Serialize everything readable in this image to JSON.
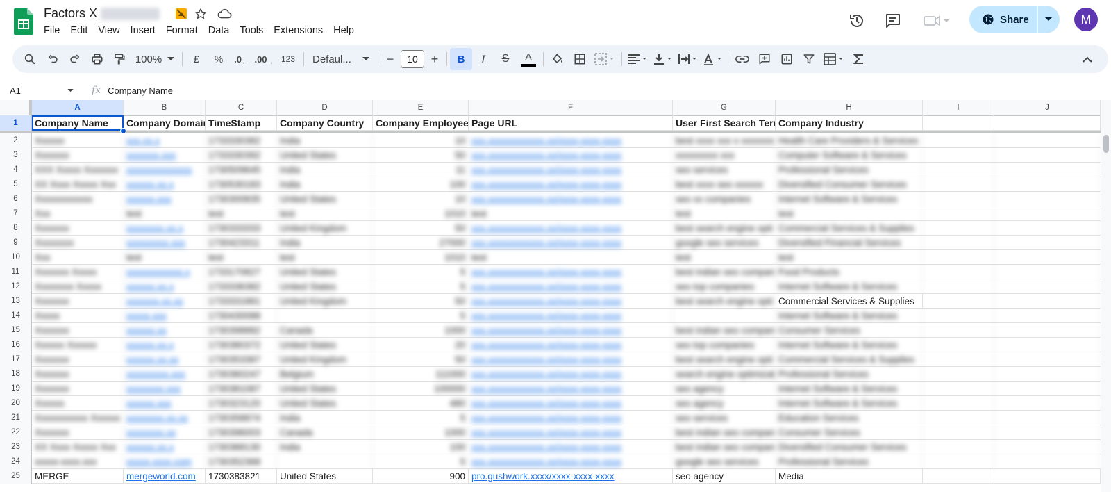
{
  "app": {
    "title": "Factors X",
    "menu": [
      "File",
      "Edit",
      "View",
      "Insert",
      "Format",
      "Data",
      "Tools",
      "Extensions",
      "Help"
    ],
    "share_label": "Share",
    "avatar_initial": "M",
    "colors": {
      "accent": "#0b57d0",
      "share_bg": "#c2e7ff",
      "avatar": "#5e35b1",
      "sheets_green": "#0f9d58"
    }
  },
  "toolbar": {
    "zoom": "100%",
    "currency": "£",
    "percent": "%",
    "dec_decrease": ".0",
    "dec_increase": ".00",
    "number_format": "123",
    "font": "Defaul...",
    "font_size": "10",
    "minus": "−",
    "plus": "+",
    "bold": "B",
    "italic": "I",
    "strike": "S",
    "text_color": "A"
  },
  "formula_bar": {
    "cell_ref": "A1",
    "fx": "fx",
    "value": "Company Name"
  },
  "sheet": {
    "columns": [
      "A",
      "B",
      "C",
      "D",
      "E",
      "F",
      "G",
      "H",
      "I",
      "J"
    ],
    "headers": [
      "Company Name",
      "Company Domain",
      "TimeStamp",
      "Company Country",
      "Company Employees",
      "Page URL",
      "User First Search Term",
      "Company Industry",
      "",
      ""
    ],
    "row_numbers": [
      "1",
      "2",
      "3",
      "4",
      "5",
      "6",
      "7",
      "8",
      "9",
      "10",
      "11",
      "12",
      "13",
      "14",
      "15",
      "16",
      "17",
      "18",
      "19",
      "20",
      "21",
      "22",
      "23",
      "24",
      "25"
    ],
    "rows": [
      [
        "Xxxxxx",
        "xxx.xx.x",
        "1733330382",
        "India",
        "10",
        "xxx.xxxxxxxxxxxx.xx/xxxx-xxxx-xxxx",
        "best xxxx xxx x xxxxxxx",
        "Health Care Providers & Services"
      ],
      [
        "Xxxxxxx",
        "xxxxxxx.xxx",
        "1733330392",
        "United States",
        "50",
        "xxx.xxxxxxxxxxxx.xx/xxxx-xxxx-xxxx",
        "xxxxxxxxx xxx",
        "Computer Software & Services"
      ],
      [
        "XXX Xxxxx Xxxxxxx",
        "xxxxxxxxxxxxxx",
        "1730509645",
        "India",
        "11",
        "xxx.xxxxxxxxxxxx.xx/xxxx-xxxx-xxxx",
        "seo services",
        "Professional Services"
      ],
      [
        "XX Xxxx Xxxxx Xxx",
        "xxxxxx.xx.x",
        "1730530183",
        "India",
        "100",
        "xxx.xxxxxxxxxxxx.xx/xxxx-xxxx-xxxx",
        "best xxxx seo xxxxxx",
        "Diversified Consumer Services"
      ],
      [
        "Xxxxxxxxxxxx",
        "xxxxxx.xxx",
        "1730300835",
        "United States",
        "10",
        "xxx.xxxxxxxxxxxx.xx/xxxx-xxxx-xxxx",
        "seo xx companies",
        "Internet Software & Services"
      ],
      [
        "Xxx",
        "test",
        "test",
        "test",
        "1010",
        "test",
        "test",
        "test"
      ],
      [
        "Xxxxxxx",
        "xxxxxxxx.xx.x",
        "1730333333",
        "United Kingdom",
        "50",
        "xxx.xxxxxxxxxxxx.xx/xxxx-xxxx-xxxx",
        "best search engine opti",
        "Commercial Services & Supplies"
      ],
      [
        "Xxxxxxxx",
        "xxxxxxxxx.xxx",
        "1730423311",
        "India",
        "27000",
        "xxx.xxxxxxxxxxxx.xx/xxxx-xxxx-xxxx",
        "google seo services",
        "Diversified Financial Services"
      ],
      [
        "Xxx",
        "test",
        "test",
        "test",
        "1010",
        "test",
        "test",
        "test"
      ],
      [
        "Xxxxxxx Xxxxx",
        "xxxxxxxxxxxx.x",
        "1733170827",
        "United States",
        "5",
        "xxx.xxxxxxxxxxxx.xx/xxxx-xxxx-xxxx",
        "best indian seo compan",
        "Food Products"
      ],
      [
        "Xxxxxxxx Xxxxx",
        "xxxxxx.xx.x",
        "1733336382",
        "United States",
        "5",
        "xxx.xxxxxxxxxxxx.xx/xxxx-xxxx-xxxx",
        "seo top companies",
        "Internet Software & Services"
      ],
      [
        "Xxxxxxx",
        "xxxxxxx.xx.xx",
        "1733331881",
        "United Kingdom",
        "50",
        "xxx.xxxxxxxxxxxx.xx/xxxx-xxxx-xxxx",
        "best search engine opti",
        "Commercial Services & Supplies"
      ],
      [
        "Xxxxx",
        "xxxxx.xxx",
        "1730430088",
        "",
        "5",
        "xxx.xxxxxxxxxxxx.xx/xxxx-xxxx-xxxx",
        "",
        "Internet Software & Services"
      ],
      [
        "Xxxxxxx",
        "xxxxxx.xx",
        "1730398882",
        "Canada",
        "1000",
        "xxx.xxxxxxxxxxxx.xx/xxxx-xxxx-xxxx",
        "best indian seo compan",
        "Consumer Services"
      ],
      [
        "Xxxxxx Xxxxxx",
        "xxxxxx.xx.x",
        "1730380372",
        "United States",
        "20",
        "xxx.xxxxxxxxxxxx.xx/xxxx-xxxx-xxxx",
        "seo top companies",
        "Internet Software & Services"
      ],
      [
        "Xxxxxxx",
        "xxxxxx.xx.xx",
        "1730353387",
        "United Kingdom",
        "50",
        "xxx.xxxxxxxxxxxx.xx/xxxx-xxxx-xxxx",
        "best search engine opti",
        "Commercial Services & Supplies"
      ],
      [
        "Xxxxxxx",
        "xxxxxxxxx.xxx",
        "1730360247",
        "Belgium",
        "111000",
        "xxx.xxxxxxxxxxxx.xx/xxxx-xxxx-xxxx",
        "search engine optimizat",
        "Professional Services"
      ],
      [
        "Xxxxxxx",
        "xxxxxxxx.xxx",
        "1730381087",
        "United States",
        "100000",
        "xxx.xxxxxxxxxxxx.xx/xxxx-xxxx-xxxx",
        "seo agency",
        "Internet Software & Services"
      ],
      [
        "Xxxxxx",
        "xxxxxx.xxx",
        "1730323120",
        "United States",
        "480",
        "xxx.xxxxxxxxxxxx.xx/xxxx-xxxx-xxxx",
        "seo agency",
        "Internet Software & Services"
      ],
      [
        "Xxxxxxxxxxx Xxxxxx",
        "xxxxxxxx.xx.xx",
        "1730358874",
        "India",
        "5",
        "xxx.xxxxxxxxxxxx.xx/xxxx-xxxx-xxxx",
        "seo services",
        "Education Services"
      ],
      [
        "Xxxxxxx",
        "xxxxxxxx.xx",
        "1730396003",
        "Canada",
        "1000",
        "xxx.xxxxxxxxxxxx.xx/xxxx-xxxx-xxxx",
        "best indian seo compan",
        "Consumer Services"
      ],
      [
        "XX Xxxx Xxxxx Xxx",
        "xxxxxx.xx.x",
        "1730368130",
        "India",
        "100",
        "xxx.xxxxxxxxxxxx.xx/xxxx-xxxx-xxxx",
        "best indian seo compan",
        "Diversified Consumer Services"
      ],
      [
        "xxxxx-xxxx.xxx",
        "xxxxx.xxxx.com",
        "1730352368",
        "",
        "5",
        "xxx.xxxxxxxxxxxx.xx/xxxx-xxxx-xxxx",
        "google seo services",
        "Professional Services"
      ],
      [
        "MERGE",
        "mergeworld.com",
        "1730383821",
        "United States",
        "900",
        "pro.gushwork.xxxx/xxxx-xxxx-xxxx",
        "seo agency",
        "Media"
      ]
    ]
  }
}
